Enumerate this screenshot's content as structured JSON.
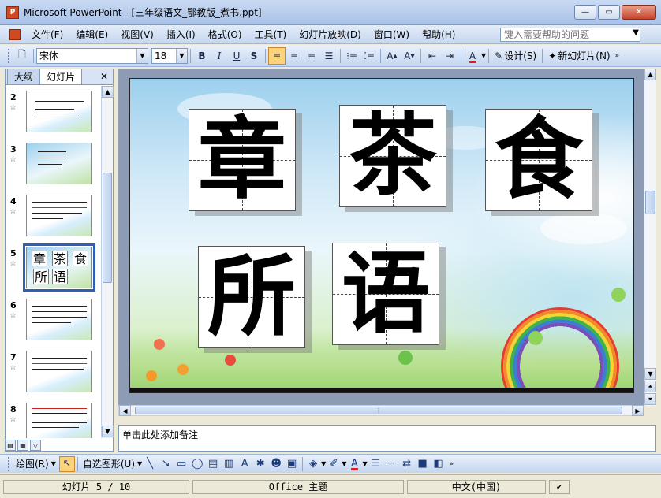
{
  "window": {
    "title": "Microsoft PowerPoint - [三年级语文_鄂教版_煮书.ppt]",
    "app_icon": "powerpoint-icon"
  },
  "menu": {
    "items": [
      "文件(F)",
      "编辑(E)",
      "视图(V)",
      "插入(I)",
      "格式(O)",
      "工具(T)",
      "幻灯片放映(D)",
      "窗口(W)",
      "帮助(H)"
    ],
    "help_placeholder": "键入需要帮助的问题"
  },
  "toolbar": {
    "font_name": "宋体",
    "font_size": "18",
    "bold": "B",
    "italic": "I",
    "underline": "U",
    "shadow": "S",
    "design_label": "设计(S)",
    "new_slide_label": "新幻灯片(N)"
  },
  "left_pane": {
    "tabs": [
      "大纲",
      "幻灯片"
    ],
    "active_tab": "幻灯片",
    "slides": [
      {
        "num": "2"
      },
      {
        "num": "3"
      },
      {
        "num": "4"
      },
      {
        "num": "5",
        "chars": [
          "章",
          "茶",
          "食",
          "所",
          "语"
        ]
      },
      {
        "num": "6"
      },
      {
        "num": "7"
      },
      {
        "num": "8"
      }
    ],
    "selected": "5"
  },
  "slide": {
    "chars_row1": [
      "章",
      "茶",
      "食"
    ],
    "chars_row2": [
      "所",
      "语"
    ]
  },
  "notes": {
    "placeholder": "单击此处添加备注"
  },
  "drawbar": {
    "draw_label": "绘图(R)",
    "autoshape_label": "自选图形(U)"
  },
  "status": {
    "slide_pos": "幻灯片 5 / 10",
    "theme": "Office 主题",
    "language": "中文(中国)"
  }
}
